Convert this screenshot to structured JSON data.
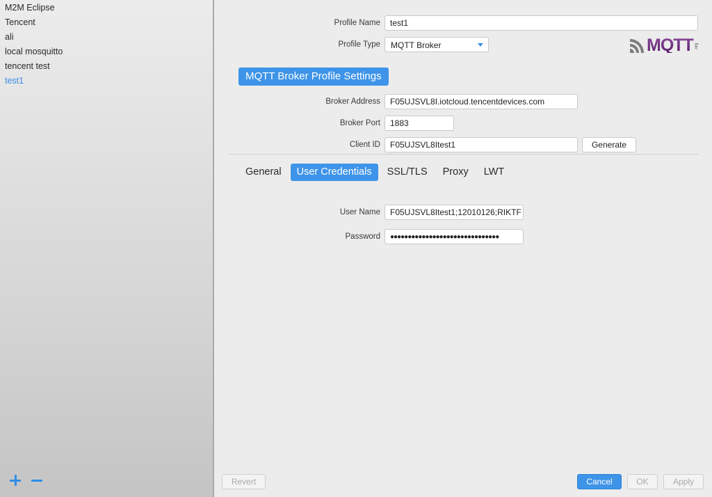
{
  "sidebar": {
    "profiles": [
      "M2M Eclipse",
      "Tencent",
      "ali",
      "local mosquitto",
      "tencent test",
      "test1"
    ],
    "selected_index": 5,
    "add_icon": "plus-icon",
    "remove_icon": "minus-icon"
  },
  "form": {
    "profile_name_label": "Profile Name",
    "profile_name_value": "test1",
    "profile_type_label": "Profile Type",
    "profile_type_value": "MQTT Broker",
    "logo_text": "MQTT",
    "logo_sub": ".org"
  },
  "section": {
    "title": "MQTT Broker Profile Settings"
  },
  "broker": {
    "address_label": "Broker Address",
    "address_value": "F05UJSVL8I.iotcloud.tencentdevices.com",
    "port_label": "Broker Port",
    "port_value": "1883",
    "client_id_label": "Client ID",
    "client_id_value": "F05UJSVL8Itest1",
    "generate_label": "Generate"
  },
  "tabs": {
    "items": [
      "General",
      "User Credentials",
      "SSL/TLS",
      "Proxy",
      "LWT"
    ],
    "active_index": 1
  },
  "credentials": {
    "username_label": "User Name",
    "username_value": "F05UJSVL8Itest1;12010126;RIKTF",
    "password_label": "Password",
    "password_value": "●●●●●●●●●●●●●●●●●●●●●●●●●●●●●●●"
  },
  "footer": {
    "revert_label": "Revert",
    "cancel_label": "Cancel",
    "ok_label": "OK",
    "apply_label": "Apply"
  },
  "colors": {
    "accent": "#3e94e8",
    "logo_purple": "#6a2c7a"
  }
}
